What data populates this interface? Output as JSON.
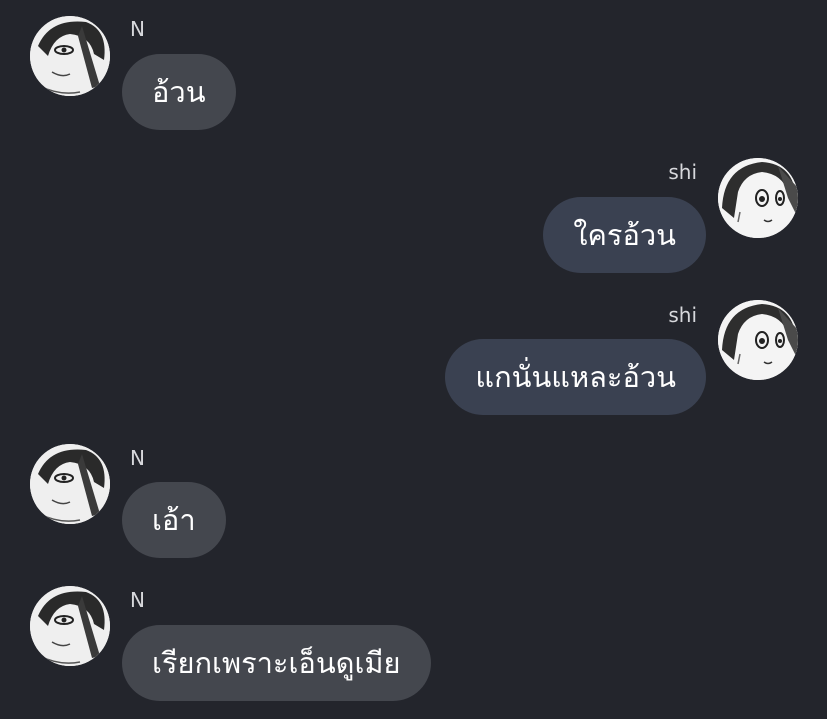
{
  "colors": {
    "background": "#23252c",
    "incoming_bubble": "#44474e",
    "outgoing_bubble": "#3a4151",
    "text": "#ffffff",
    "name_text": "#d7d8dc"
  },
  "messages": [
    {
      "sender": "N",
      "direction": "incoming",
      "text": "อ้วน",
      "avatar_icon": "manga-avatar-icon"
    },
    {
      "sender": "shi",
      "direction": "outgoing",
      "text": "ใครอ้วน",
      "avatar_icon": "manga-avatar-icon"
    },
    {
      "sender": "shi",
      "direction": "outgoing",
      "text": "แกนั่นแหละอ้วน",
      "avatar_icon": "manga-avatar-icon"
    },
    {
      "sender": "N",
      "direction": "incoming",
      "text": "เอ้า",
      "avatar_icon": "manga-avatar-icon"
    },
    {
      "sender": "N",
      "direction": "incoming",
      "text": "เรียกเพราะเอ็นดูเมีย",
      "avatar_icon": "manga-avatar-icon"
    }
  ]
}
